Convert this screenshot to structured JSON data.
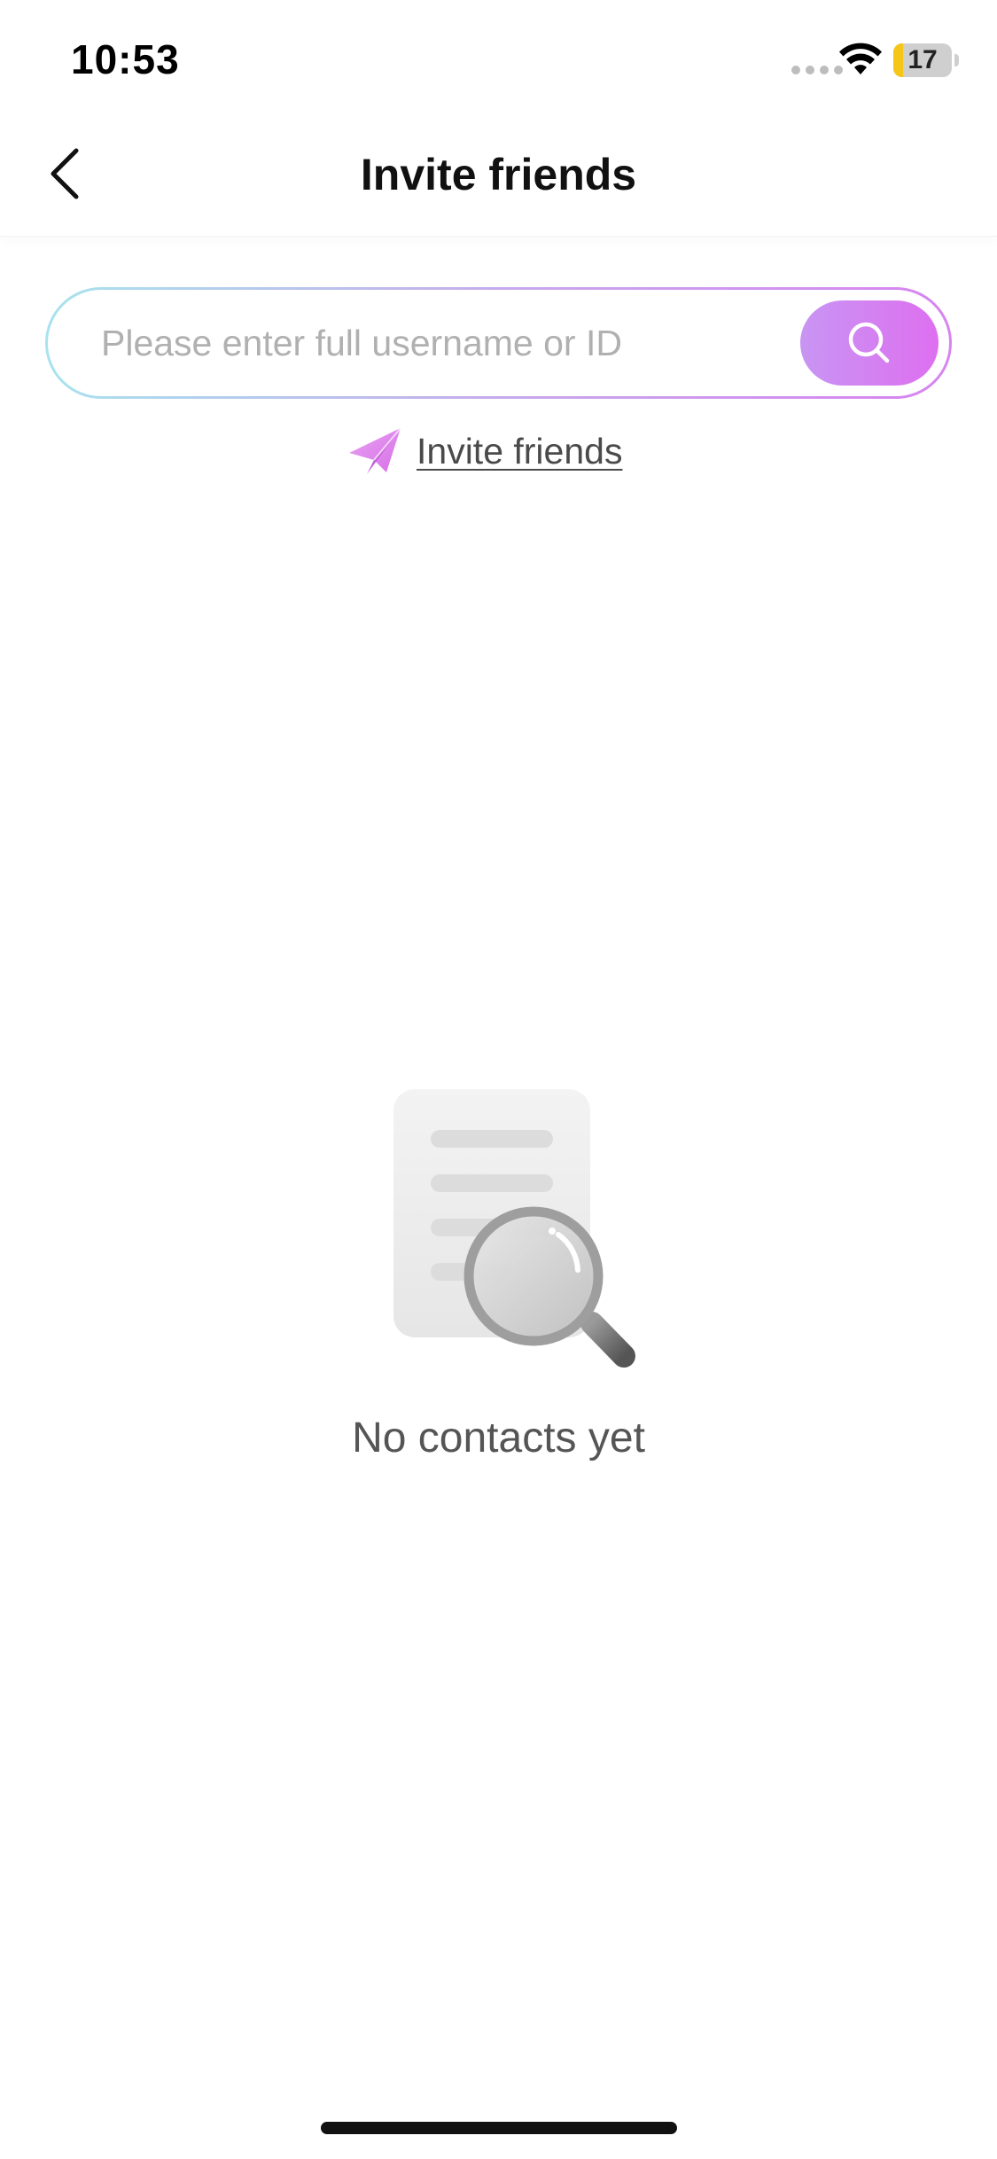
{
  "status_bar": {
    "time": "10:53",
    "battery_level": "17",
    "battery_fraction": 0.17
  },
  "header": {
    "title": "Invite friends",
    "back_icon": "chevron-left-icon"
  },
  "search": {
    "placeholder": "Please enter full username or ID",
    "value": "",
    "button_icon": "search-icon"
  },
  "invite_link": {
    "label": "Invite friends",
    "icon": "paper-plane-icon"
  },
  "empty_state": {
    "icon": "document-search-icon",
    "message": "No contacts yet"
  },
  "colors": {
    "accent_start": "#c895f2",
    "accent_end": "#de6ff0",
    "border_start": "#a8e3ee",
    "battery_fill": "#f5c518"
  }
}
